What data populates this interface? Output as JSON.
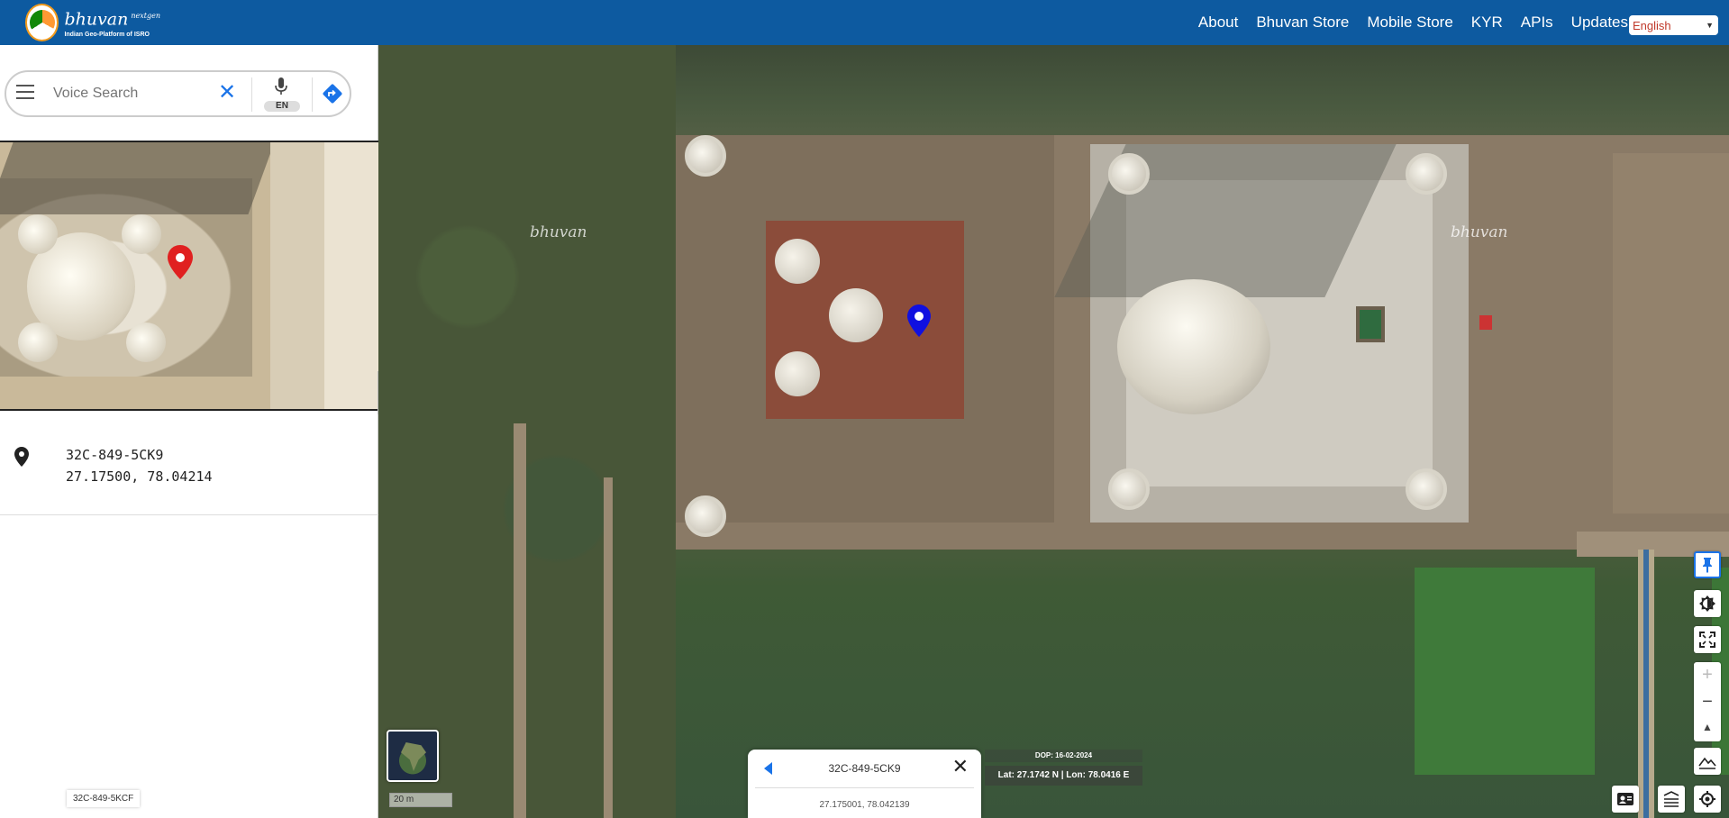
{
  "header": {
    "logo_title": "bhuvan",
    "logo_sup": "nextgen",
    "logo_subtitle": "Indian Geo-Platform of ISRO",
    "nav": [
      "About",
      "Bhuvan Store",
      "Mobile Store",
      "KYR",
      "APIs",
      "Updates"
    ],
    "language": "English"
  },
  "search": {
    "placeholder": "Voice Search",
    "lang_badge": "EN"
  },
  "place": {
    "code": "32C-849-5CK9",
    "coords": "27.17500, 78.04214"
  },
  "bottom_code": "32C-849-5KCF",
  "map": {
    "watermark": "bhuvan",
    "scale": "20 m"
  },
  "popup": {
    "title": "32C-849-5CK9",
    "coords": "27.175001, 78.042139"
  },
  "info": {
    "dop": "DOP: 16-02-2024",
    "latlon": "Lat: 27.1742 N | Lon: 78.0416 E"
  },
  "colors": {
    "header_bg": "#0d5aa0",
    "accent": "#1a73e8",
    "preview_pin": "#e02020",
    "map_pin": "#1010e0"
  }
}
